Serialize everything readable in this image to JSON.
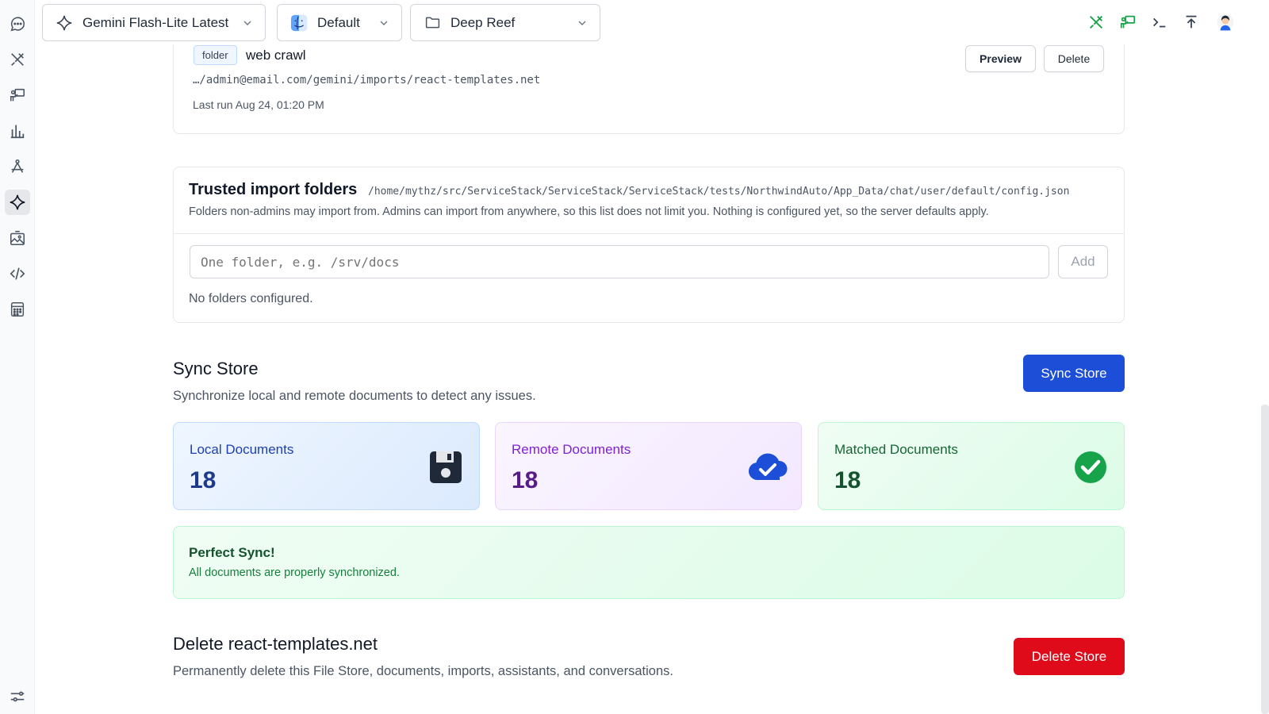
{
  "topbar": {
    "model_label": "Gemini Flash-Lite Latest",
    "profile_label": "Default",
    "store_label": "Deep Reef"
  },
  "import_item": {
    "tag": "folder",
    "name": "web crawl",
    "path": "…/admin@email.com/gemini/imports/react-templates.net",
    "last_run": "Last run Aug 24, 01:20 PM",
    "preview_label": "Preview",
    "delete_label": "Delete"
  },
  "trusted": {
    "title": "Trusted import folders",
    "config_path": "/home/mythz/src/ServiceStack/ServiceStack/ServiceStack/tests/NorthwindAuto/App_Data/chat/user/default/config.json",
    "description": "Folders non-admins may import from. Admins can import from anywhere, so this list does not limit you. Nothing is configured yet, so the server defaults apply.",
    "input_placeholder": "One folder, e.g. /srv/docs",
    "add_label": "Add",
    "empty_text": "No folders configured."
  },
  "sync": {
    "title": "Sync Store",
    "description": "Synchronize local and remote documents to detect any issues.",
    "button_label": "Sync Store",
    "stats": [
      {
        "label": "Local Documents",
        "value": "18",
        "icon": "floppy-disk-icon"
      },
      {
        "label": "Remote Documents",
        "value": "18",
        "icon": "cloud-check-icon"
      },
      {
        "label": "Matched Documents",
        "value": "18",
        "icon": "check-circle-icon"
      }
    ],
    "status_title": "Perfect Sync!",
    "status_text": "All documents are properly synchronized."
  },
  "delete_store": {
    "title": "Delete react-templates.net",
    "description": "Permanently delete this File Store, documents, imports, assistants, and conversations.",
    "button_label": "Delete Store"
  },
  "colors": {
    "primary": "#1d4ed8",
    "danger": "#dc2626",
    "success": "#16a34a",
    "local_text": "#1e40af",
    "remote_text": "#7e22ce",
    "matched_text": "#166534"
  }
}
